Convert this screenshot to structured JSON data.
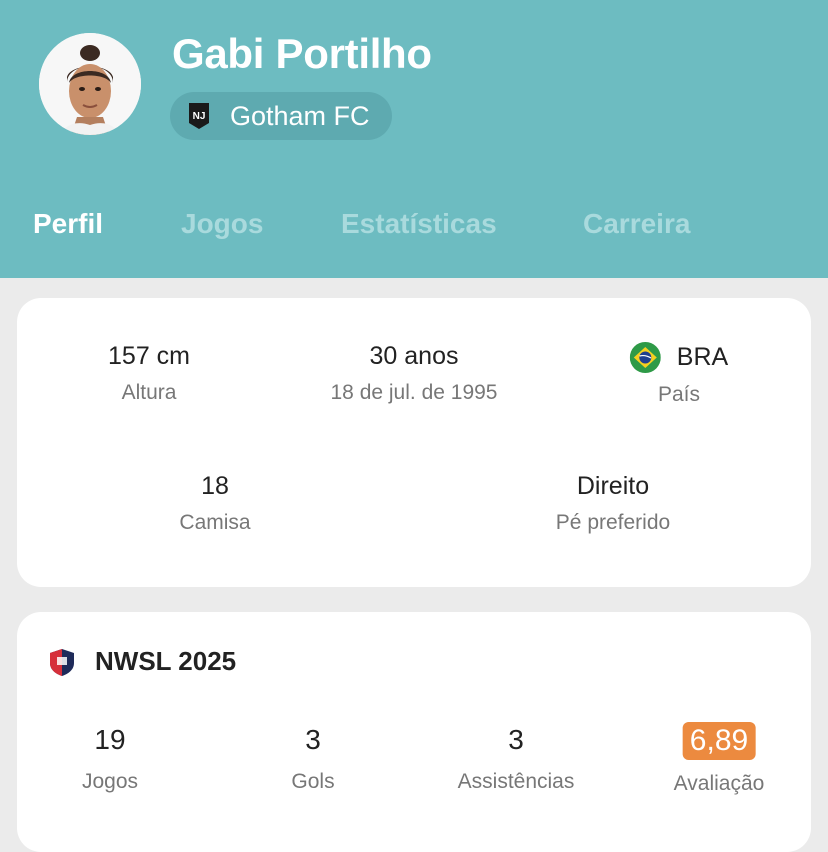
{
  "header": {
    "player_name": "Gabi Portilho",
    "team_name": "Gotham FC",
    "team_logo_text": "NJ",
    "avatar_icon": "player-photo",
    "background_color": "#6dbcc1"
  },
  "tabs": [
    {
      "label": "Perfil",
      "active": true
    },
    {
      "label": "Jogos",
      "active": false
    },
    {
      "label": "Estatísticas",
      "active": false
    },
    {
      "label": "Carreira",
      "active": false
    }
  ],
  "profile": {
    "height": {
      "value": "157 cm",
      "label": "Altura"
    },
    "age": {
      "value": "30 anos",
      "label": "18 de jul. de 1995"
    },
    "country": {
      "value": "BRA",
      "label": "País",
      "flag_icon": "brazil-flag"
    },
    "shirt": {
      "value": "18",
      "label": "Camisa"
    },
    "foot": {
      "value": "Direito",
      "label": "Pé preferido"
    }
  },
  "league": {
    "name": "NWSL 2025",
    "logo_icon": "nwsl-logo",
    "stats": [
      {
        "value": "19",
        "label": "Jogos"
      },
      {
        "value": "3",
        "label": "Gols"
      },
      {
        "value": "3",
        "label": "Assistências"
      },
      {
        "value": "6,89",
        "label": "Avaliação",
        "highlight_color": "#ec8a3f"
      }
    ]
  }
}
